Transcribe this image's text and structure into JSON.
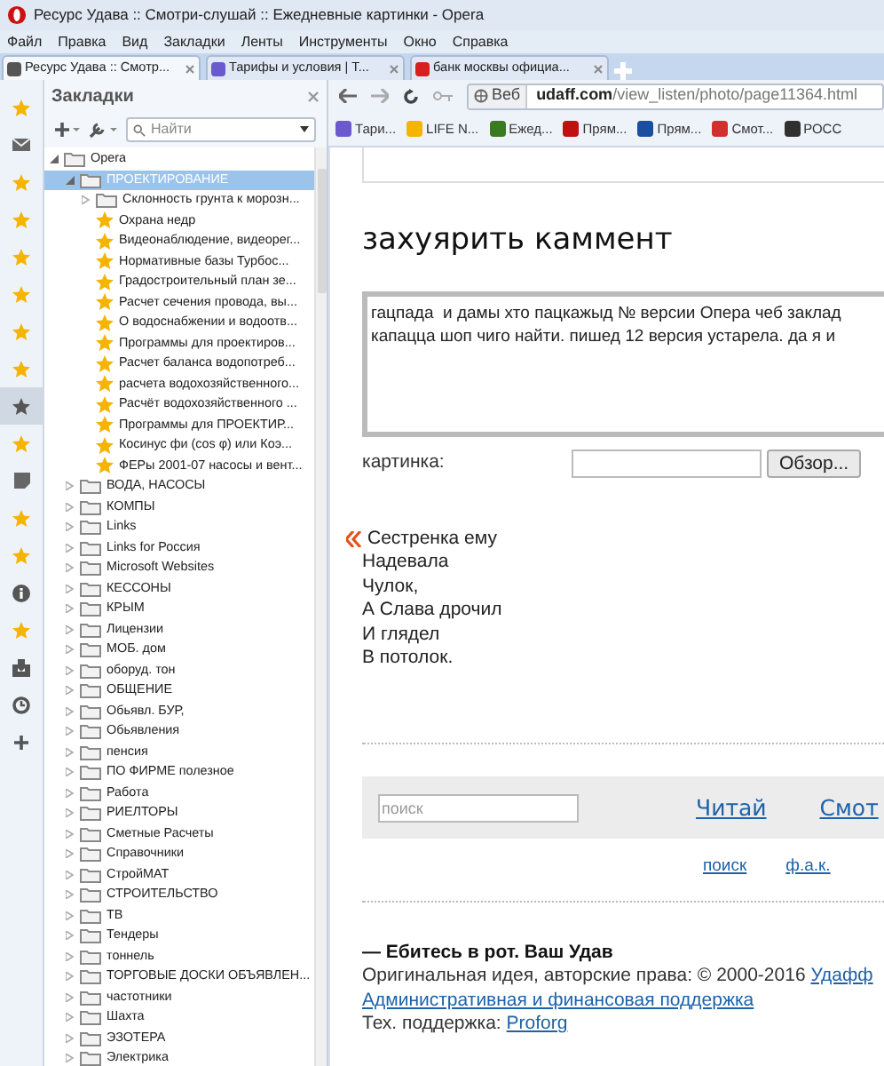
{
  "window": {
    "title": "Ресурс Удава :: Смотри-слушай :: Ежедневные картинки - Opera"
  },
  "menu": [
    "Файл",
    "Правка",
    "Вид",
    "Закладки",
    "Ленты",
    "Инструменты",
    "Окно",
    "Справка"
  ],
  "tabs": [
    {
      "label": "Ресурс Удава :: Смотр...",
      "selected": true,
      "color": "#555555"
    },
    {
      "label": "Тарифы и условия | Т...",
      "selected": false,
      "color": "#6a5acd"
    },
    {
      "label": "банк москвы официа...",
      "selected": false,
      "color": "#d62020"
    }
  ],
  "panel_buttons": [
    {
      "kind": "star",
      "selected": false
    },
    {
      "kind": "mail",
      "selected": false
    },
    {
      "kind": "star",
      "selected": false
    },
    {
      "kind": "star",
      "selected": false
    },
    {
      "kind": "star",
      "selected": false
    },
    {
      "kind": "star",
      "selected": false
    },
    {
      "kind": "star",
      "selected": false
    },
    {
      "kind": "star",
      "selected": false
    },
    {
      "kind": "bookmarks",
      "selected": true
    },
    {
      "kind": "star",
      "selected": false
    },
    {
      "kind": "note",
      "selected": false
    },
    {
      "kind": "star",
      "selected": false
    },
    {
      "kind": "star",
      "selected": false
    },
    {
      "kind": "info",
      "selected": false
    },
    {
      "kind": "star",
      "selected": false
    },
    {
      "kind": "download",
      "selected": false
    },
    {
      "kind": "history",
      "selected": false
    },
    {
      "kind": "add",
      "selected": false
    }
  ],
  "sidebar": {
    "title": "Закладки",
    "search": {
      "placeholder": "Найти"
    },
    "tree": [
      {
        "label": "Opera",
        "kind": "folder",
        "expanded": true,
        "selected": false,
        "children": [
          {
            "label": "ПРОЕКТИРОВАНИЕ",
            "kind": "folder",
            "expanded": true,
            "selected": true,
            "children": [
              {
                "label": "Склонность грунта к морозн...",
                "kind": "folder",
                "expanded": false,
                "selected": false
              },
              {
                "label": "Охрана недр",
                "kind": "bookmark",
                "selected": false
              },
              {
                "label": "Видеонаблюдение, видеорег...",
                "kind": "bookmark",
                "selected": false
              },
              {
                "label": "Нормативные базы Турбос...",
                "kind": "bookmark",
                "selected": false
              },
              {
                "label": "Градостроительный план зе...",
                "kind": "bookmark",
                "selected": false
              },
              {
                "label": "Расчет сечения провода, вы...",
                "kind": "bookmark",
                "selected": false
              },
              {
                "label": "О водоснабжении и водоотв...",
                "kind": "bookmark",
                "selected": false
              },
              {
                "label": "Программы для проектиров...",
                "kind": "bookmark",
                "selected": false
              },
              {
                "label": "Расчет баланса водопотреб...",
                "kind": "bookmark",
                "selected": false
              },
              {
                "label": "расчета водохозяйственного...",
                "kind": "bookmark",
                "selected": false
              },
              {
                "label": "Расчёт водохозяйственного ...",
                "kind": "bookmark",
                "selected": false
              },
              {
                "label": "Программы для ПРОЕКТИР...",
                "kind": "bookmark",
                "selected": false
              },
              {
                "label": "Косинус фи (cos φ) или Коэ...",
                "kind": "bookmark",
                "selected": false
              },
              {
                "label": "ФЕРы 2001-07 насосы и вент...",
                "kind": "bookmark",
                "selected": false
              }
            ]
          },
          {
            "label": "ВОДА, НАСОСЫ",
            "kind": "folder",
            "expanded": false,
            "selected": false
          },
          {
            "label": "КОМПЫ",
            "kind": "folder",
            "expanded": false,
            "selected": false
          },
          {
            "label": "Links",
            "kind": "folder",
            "expanded": false,
            "selected": false
          },
          {
            "label": "Links for Россия",
            "kind": "folder",
            "expanded": false,
            "selected": false
          },
          {
            "label": "Microsoft Websites",
            "kind": "folder",
            "expanded": false,
            "selected": false
          },
          {
            "label": "КЕССОНЫ",
            "kind": "folder",
            "expanded": false,
            "selected": false
          },
          {
            "label": "КРЫМ",
            "kind": "folder",
            "expanded": false,
            "selected": false
          },
          {
            "label": "Лицензии",
            "kind": "folder",
            "expanded": false,
            "selected": false
          },
          {
            "label": "МОБ. дом",
            "kind": "folder",
            "expanded": false,
            "selected": false
          },
          {
            "label": "оборуд. тон",
            "kind": "folder",
            "expanded": false,
            "selected": false
          },
          {
            "label": "ОБЩЕНИЕ",
            "kind": "folder",
            "expanded": false,
            "selected": false
          },
          {
            "label": "Обьявл. БУР,",
            "kind": "folder",
            "expanded": false,
            "selected": false
          },
          {
            "label": "Обьявления",
            "kind": "folder",
            "expanded": false,
            "selected": false
          },
          {
            "label": "пенсия",
            "kind": "folder",
            "expanded": false,
            "selected": false
          },
          {
            "label": "ПО ФИРМЕ полезное",
            "kind": "folder",
            "expanded": false,
            "selected": false
          },
          {
            "label": "Работа",
            "kind": "folder",
            "expanded": false,
            "selected": false
          },
          {
            "label": "РИЕЛТОРЫ",
            "kind": "folder",
            "expanded": false,
            "selected": false
          },
          {
            "label": "Сметные Расчеты",
            "kind": "folder",
            "expanded": false,
            "selected": false
          },
          {
            "label": "Справочники",
            "kind": "folder",
            "expanded": false,
            "selected": false
          },
          {
            "label": "СтройМАТ",
            "kind": "folder",
            "expanded": false,
            "selected": false
          },
          {
            "label": "СТРОИТЕЛЬСТВО",
            "kind": "folder",
            "expanded": false,
            "selected": false
          },
          {
            "label": "ТВ",
            "kind": "folder",
            "expanded": false,
            "selected": false
          },
          {
            "label": "Тендеры",
            "kind": "folder",
            "expanded": false,
            "selected": false
          },
          {
            "label": "тоннель",
            "kind": "folder",
            "expanded": false,
            "selected": false
          },
          {
            "label": "ТОРГОВЫЕ ДОСКИ ОБЪЯВЛЕН...",
            "kind": "folder",
            "expanded": false,
            "selected": false
          },
          {
            "label": "частотники",
            "kind": "folder",
            "expanded": false,
            "selected": false
          },
          {
            "label": "Шахта",
            "kind": "folder",
            "expanded": false,
            "selected": false
          },
          {
            "label": "ЭЗОТЕРА",
            "kind": "folder",
            "expanded": false,
            "selected": false
          },
          {
            "label": "Электрика",
            "kind": "folder",
            "expanded": false,
            "selected": false
          }
        ]
      }
    ]
  },
  "address_bar": {
    "badge": "Веб",
    "domain": "udaff.com",
    "path": "/view_listen/photo/page11364.html"
  },
  "bookmarks_bar": [
    {
      "label": "Тари...",
      "color": "#6a5acd"
    },
    {
      "label": "LIFE N...",
      "color": "#f5b400"
    },
    {
      "label": "Ежед...",
      "color": "#3a7a20"
    },
    {
      "label": "Прям...",
      "color": "#c01010"
    },
    {
      "label": "Прям...",
      "color": "#1a4fa0"
    },
    {
      "label": "Смот...",
      "color": "#d03030"
    },
    {
      "label": "РОСС",
      "color": "#303030"
    }
  ],
  "page": {
    "heading": "захуярить каммент",
    "comment": {
      "value": "гацпада  и дамы хто пацкажыд № версии Опера чеб заклад\nкапацца шоп чиго найти. пишед 12 версия устарела. да я и"
    },
    "picture_label": "картинка:",
    "browse_button": "Обзор...",
    "poem": [
      "Сестренка ему",
      "Надевала",
      "Чулок,",
      "А Слава дрочил",
      "И глядел",
      "В потолок."
    ],
    "search": {
      "placeholder": "поиск"
    },
    "nav_links": [
      "Читай",
      "Смот"
    ],
    "small_links": [
      "поиск",
      "ф.а.к."
    ],
    "footer": {
      "motto": "— Ебитесь в рот. Ваш Удав",
      "copyright": "Оригинальная идея, авторские права: © 2000-2016 ",
      "copyright_link": "Удафф",
      "support_link": "Административная и финансовая поддержка",
      "tech": "Тех. поддержка: ",
      "tech_link": "Proforg"
    }
  }
}
